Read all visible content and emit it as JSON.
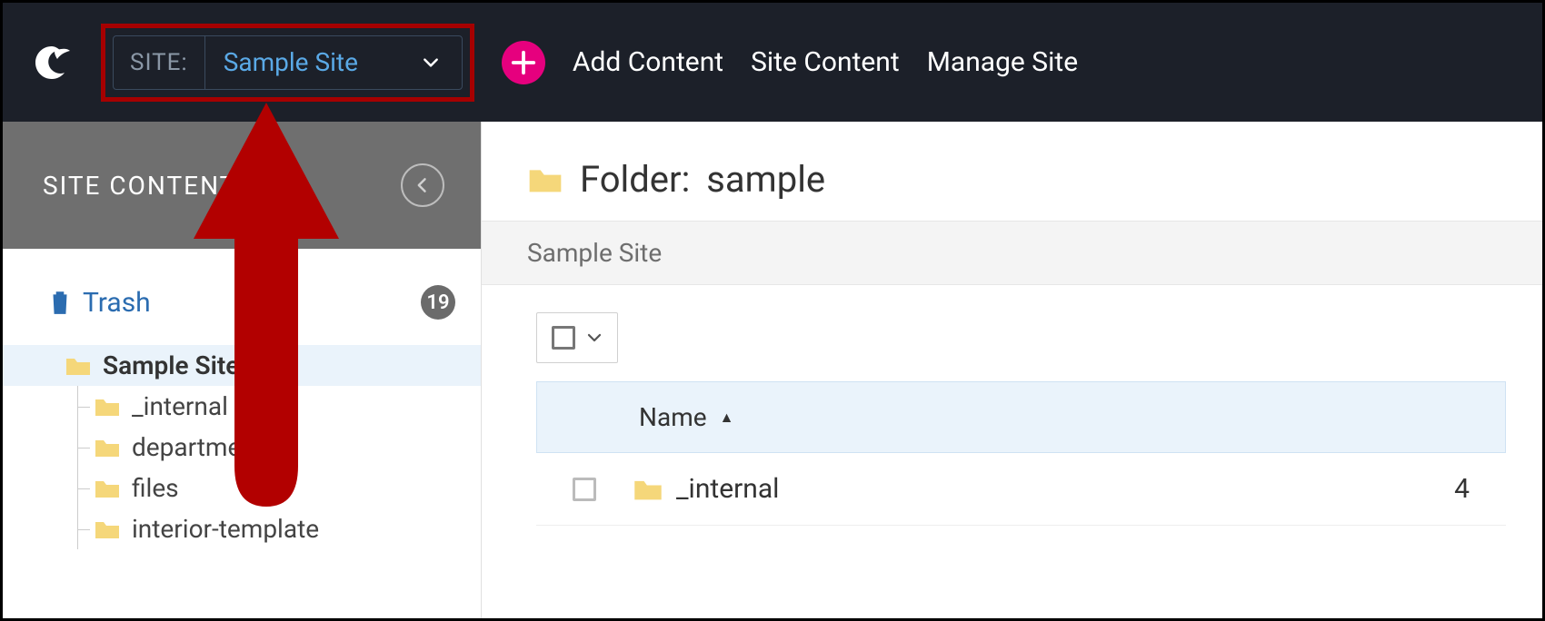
{
  "header": {
    "site_label": "SITE:",
    "site_value": "Sample Site",
    "nav": {
      "add_content": "Add Content",
      "site_content": "Site Content",
      "manage_site": "Manage Site"
    }
  },
  "sidebar": {
    "title": "SITE CONTENT",
    "trash_label": "Trash",
    "trash_count": "19",
    "tree": {
      "root": "Sample Site",
      "children": [
        "_internal",
        "departmer",
        "files",
        "interior-template"
      ]
    }
  },
  "main": {
    "title_prefix": "Folder:",
    "title_name": "sample",
    "breadcrumb": "Sample Site",
    "table": {
      "col_name": "Name",
      "rows": [
        {
          "name": "_internal",
          "count": "4"
        }
      ]
    }
  }
}
